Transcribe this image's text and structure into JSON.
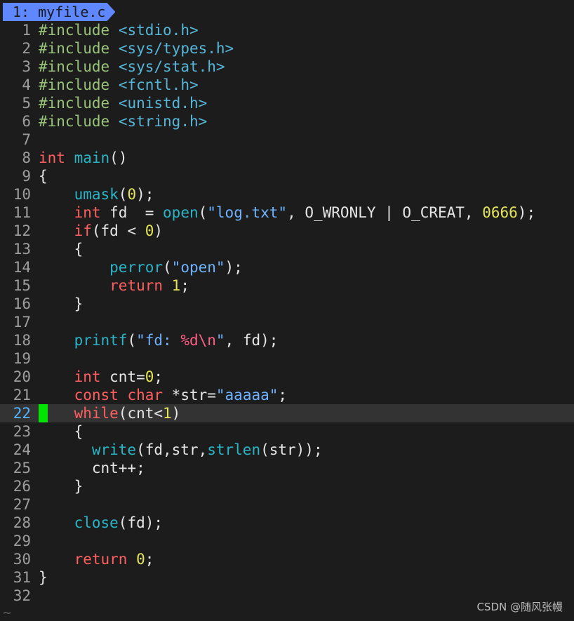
{
  "tab": {
    "label": "1: myfile.c"
  },
  "cursor_line": 22,
  "lines": [
    {
      "n": "1",
      "tokens": [
        {
          "t": "#include",
          "c": "pre"
        },
        {
          "t": " ",
          "c": "op"
        },
        {
          "t": "<stdio.h>",
          "c": "inc"
        }
      ]
    },
    {
      "n": "2",
      "tokens": [
        {
          "t": "#include",
          "c": "pre"
        },
        {
          "t": " ",
          "c": "op"
        },
        {
          "t": "<sys/types.h>",
          "c": "inc"
        }
      ]
    },
    {
      "n": "3",
      "tokens": [
        {
          "t": "#include",
          "c": "pre"
        },
        {
          "t": " ",
          "c": "op"
        },
        {
          "t": "<sys/stat.h>",
          "c": "inc"
        }
      ]
    },
    {
      "n": "4",
      "tokens": [
        {
          "t": "#include",
          "c": "pre"
        },
        {
          "t": " ",
          "c": "op"
        },
        {
          "t": "<fcntl.h>",
          "c": "inc"
        }
      ]
    },
    {
      "n": "5",
      "tokens": [
        {
          "t": "#include",
          "c": "pre"
        },
        {
          "t": " ",
          "c": "op"
        },
        {
          "t": "<unistd.h>",
          "c": "inc"
        }
      ]
    },
    {
      "n": "6",
      "tokens": [
        {
          "t": "#include",
          "c": "pre"
        },
        {
          "t": " ",
          "c": "op"
        },
        {
          "t": "<string.h>",
          "c": "inc"
        }
      ]
    },
    {
      "n": "7",
      "tokens": []
    },
    {
      "n": "8",
      "tokens": [
        {
          "t": "int",
          "c": "kw"
        },
        {
          "t": " ",
          "c": "op"
        },
        {
          "t": "main",
          "c": "fn"
        },
        {
          "t": "()",
          "c": "op"
        }
      ]
    },
    {
      "n": "9",
      "tokens": [
        {
          "t": "{",
          "c": "op"
        }
      ]
    },
    {
      "n": "10",
      "tokens": [
        {
          "t": "    ",
          "c": "op"
        },
        {
          "t": "umask",
          "c": "fn"
        },
        {
          "t": "(",
          "c": "op"
        },
        {
          "t": "0",
          "c": "num"
        },
        {
          "t": ");",
          "c": "op"
        }
      ]
    },
    {
      "n": "11",
      "tokens": [
        {
          "t": "    ",
          "c": "op"
        },
        {
          "t": "int",
          "c": "kw"
        },
        {
          "t": " fd  = ",
          "c": "op"
        },
        {
          "t": "open",
          "c": "fn"
        },
        {
          "t": "(",
          "c": "op"
        },
        {
          "t": "\"log.txt\"",
          "c": "str"
        },
        {
          "t": ", O_WRONLY | O_CREAT, ",
          "c": "op"
        },
        {
          "t": "0666",
          "c": "num"
        },
        {
          "t": ");",
          "c": "op"
        }
      ]
    },
    {
      "n": "12",
      "tokens": [
        {
          "t": "    ",
          "c": "op"
        },
        {
          "t": "if",
          "c": "kw"
        },
        {
          "t": "(fd < ",
          "c": "op"
        },
        {
          "t": "0",
          "c": "num"
        },
        {
          "t": ")",
          "c": "op"
        }
      ]
    },
    {
      "n": "13",
      "tokens": [
        {
          "t": "    {",
          "c": "op"
        }
      ]
    },
    {
      "n": "14",
      "tokens": [
        {
          "t": "        ",
          "c": "op"
        },
        {
          "t": "perror",
          "c": "fn"
        },
        {
          "t": "(",
          "c": "op"
        },
        {
          "t": "\"open\"",
          "c": "str"
        },
        {
          "t": ");",
          "c": "op"
        }
      ]
    },
    {
      "n": "15",
      "tokens": [
        {
          "t": "        ",
          "c": "op"
        },
        {
          "t": "return",
          "c": "kw"
        },
        {
          "t": " ",
          "c": "op"
        },
        {
          "t": "1",
          "c": "num"
        },
        {
          "t": ";",
          "c": "op"
        }
      ]
    },
    {
      "n": "16",
      "tokens": [
        {
          "t": "    }",
          "c": "op"
        }
      ]
    },
    {
      "n": "17",
      "tokens": []
    },
    {
      "n": "18",
      "tokens": [
        {
          "t": "    ",
          "c": "op"
        },
        {
          "t": "printf",
          "c": "fn"
        },
        {
          "t": "(",
          "c": "op"
        },
        {
          "t": "\"fd: ",
          "c": "str"
        },
        {
          "t": "%d\\n",
          "c": "fmt"
        },
        {
          "t": "\"",
          "c": "str"
        },
        {
          "t": ", fd);",
          "c": "op"
        }
      ]
    },
    {
      "n": "19",
      "tokens": []
    },
    {
      "n": "20",
      "tokens": [
        {
          "t": "    ",
          "c": "op"
        },
        {
          "t": "int",
          "c": "kw"
        },
        {
          "t": " cnt=",
          "c": "op"
        },
        {
          "t": "0",
          "c": "num"
        },
        {
          "t": ";",
          "c": "op"
        }
      ]
    },
    {
      "n": "21",
      "tokens": [
        {
          "t": "    ",
          "c": "op"
        },
        {
          "t": "const",
          "c": "kw"
        },
        {
          "t": " ",
          "c": "op"
        },
        {
          "t": "char",
          "c": "kw"
        },
        {
          "t": " *str=",
          "c": "op"
        },
        {
          "t": "\"aaaaa\"",
          "c": "str"
        },
        {
          "t": ";",
          "c": "op"
        }
      ]
    },
    {
      "n": "22",
      "tokens": [
        {
          "t": "    ",
          "c": "op"
        },
        {
          "t": "while",
          "c": "kw"
        },
        {
          "t": "(cnt<",
          "c": "op"
        },
        {
          "t": "1",
          "c": "num"
        },
        {
          "t": ")",
          "c": "op"
        }
      ]
    },
    {
      "n": "23",
      "tokens": [
        {
          "t": "    {",
          "c": "op"
        }
      ]
    },
    {
      "n": "24",
      "tokens": [
        {
          "t": "      ",
          "c": "op"
        },
        {
          "t": "write",
          "c": "fn"
        },
        {
          "t": "(fd,str,",
          "c": "op"
        },
        {
          "t": "strlen",
          "c": "fn"
        },
        {
          "t": "(str));",
          "c": "op"
        }
      ]
    },
    {
      "n": "25",
      "tokens": [
        {
          "t": "      cnt++;",
          "c": "op"
        }
      ]
    },
    {
      "n": "26",
      "tokens": [
        {
          "t": "    }",
          "c": "op"
        }
      ]
    },
    {
      "n": "27",
      "tokens": []
    },
    {
      "n": "28",
      "tokens": [
        {
          "t": "    ",
          "c": "op"
        },
        {
          "t": "close",
          "c": "fn"
        },
        {
          "t": "(fd);",
          "c": "op"
        }
      ]
    },
    {
      "n": "29",
      "tokens": []
    },
    {
      "n": "30",
      "tokens": [
        {
          "t": "    ",
          "c": "op"
        },
        {
          "t": "return",
          "c": "kw"
        },
        {
          "t": " ",
          "c": "op"
        },
        {
          "t": "0",
          "c": "num"
        },
        {
          "t": ";",
          "c": "op"
        }
      ]
    },
    {
      "n": "31",
      "tokens": [
        {
          "t": "}",
          "c": "op"
        }
      ]
    },
    {
      "n": "32",
      "tokens": []
    }
  ],
  "empty_line_marker": "~",
  "watermark": "CSDN @随风张幔",
  "colors": {
    "background": "#1c1c1c",
    "tab_active": "#5f87ff",
    "cursor": "#00e600",
    "keyword": "#ff5f5f",
    "function": "#2ab5c7",
    "string": "#6fb3ff",
    "number": "#e5e55a",
    "preprocessor": "#98c379"
  }
}
